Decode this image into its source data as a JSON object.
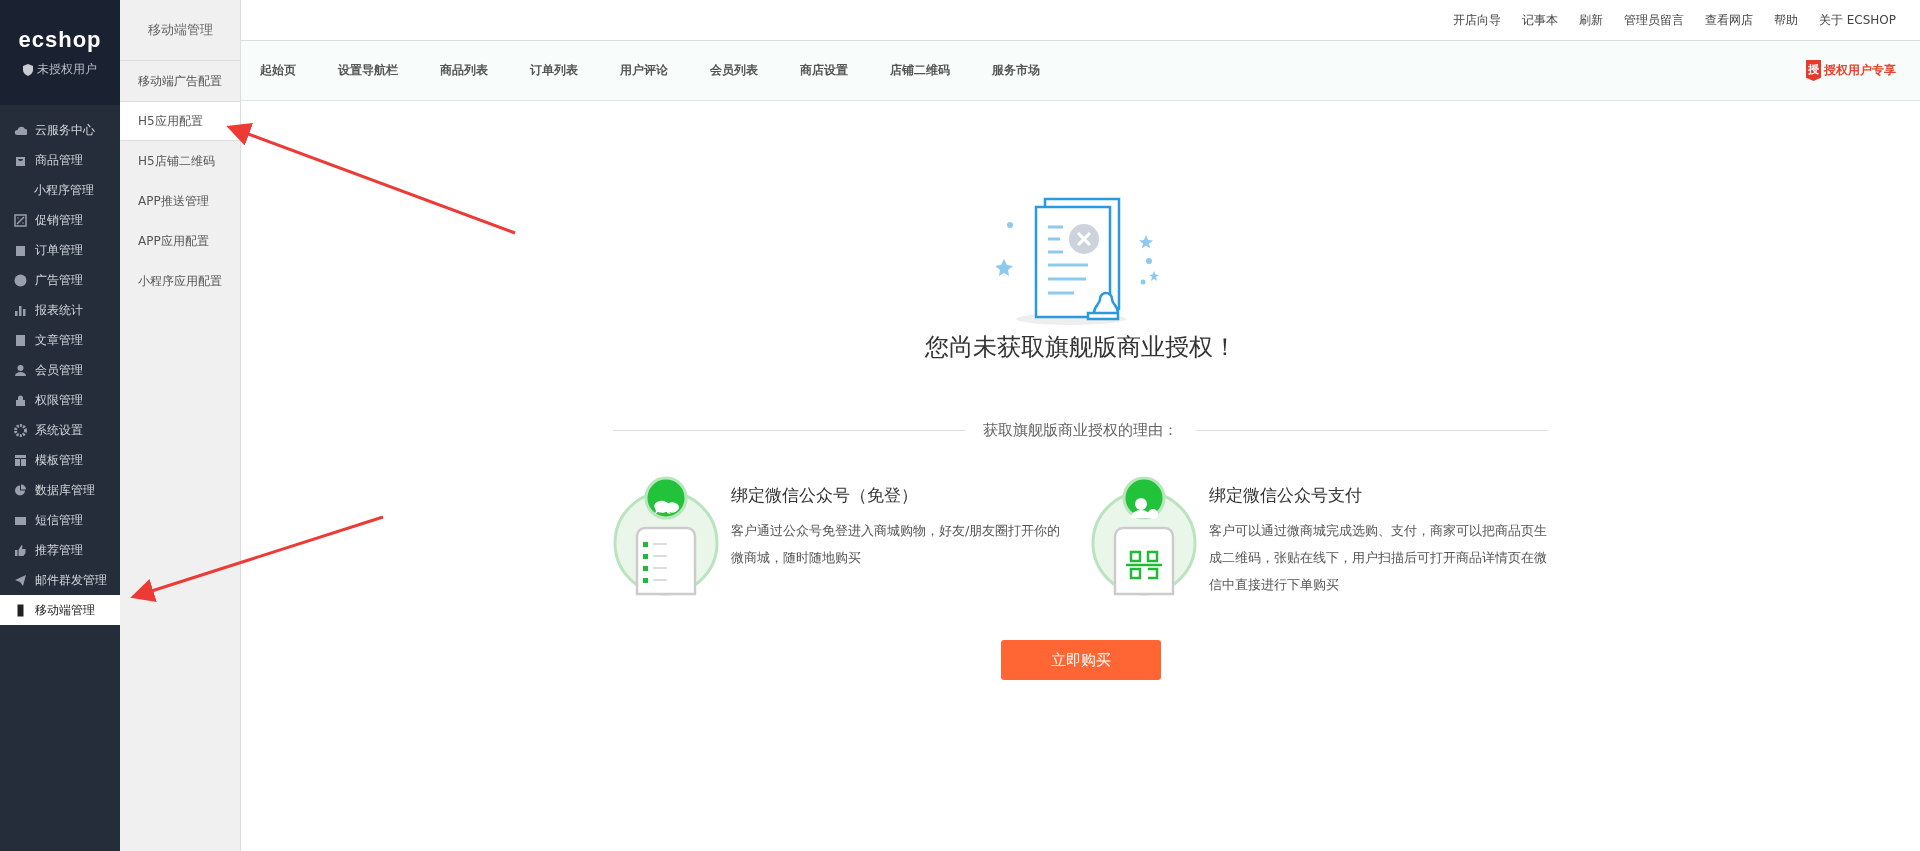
{
  "brand": {
    "logo": "ecshop",
    "user": "未授权用户"
  },
  "sidebar": {
    "items": [
      {
        "label": "云服务中心",
        "selected": false
      },
      {
        "label": "商品管理",
        "selected": false,
        "children": [
          {
            "label": "小程序管理",
            "selected": false
          }
        ]
      },
      {
        "label": "促销管理",
        "selected": false
      },
      {
        "label": "订单管理",
        "selected": false
      },
      {
        "label": "广告管理",
        "selected": false
      },
      {
        "label": "报表统计",
        "selected": false
      },
      {
        "label": "文章管理",
        "selected": false
      },
      {
        "label": "会员管理",
        "selected": false
      },
      {
        "label": "权限管理",
        "selected": false
      },
      {
        "label": "系统设置",
        "selected": false
      },
      {
        "label": "模板管理",
        "selected": false
      },
      {
        "label": "数据库管理",
        "selected": false
      },
      {
        "label": "短信管理",
        "selected": false
      },
      {
        "label": "推荐管理",
        "selected": false
      },
      {
        "label": "邮件群发管理",
        "selected": false
      },
      {
        "label": "移动端管理",
        "selected": true
      }
    ]
  },
  "subnav": {
    "title": "移动端管理",
    "items": [
      {
        "label": "移动端广告配置",
        "selected": false
      },
      {
        "label": "H5应用配置",
        "selected": true
      },
      {
        "label": "H5店铺二维码",
        "selected": false
      },
      {
        "label": "APP推送管理",
        "selected": false
      },
      {
        "label": "APP应用配置",
        "selected": false
      },
      {
        "label": "小程序应用配置",
        "selected": false
      }
    ]
  },
  "top_links": [
    "开店向导",
    "记事本",
    "刷新",
    "管理员留言",
    "查看网店",
    "帮助",
    "关于 ECSHOP"
  ],
  "nav": {
    "items": [
      "起始页",
      "设置导航栏",
      "商品列表",
      "订单列表",
      "用户评论",
      "会员列表",
      "商店设置",
      "店铺二维码",
      "服务市场"
    ],
    "badge_icon": "授",
    "badge": "授权用户专享"
  },
  "notice": {
    "title": "您尚未获取旗舰版商业授权！",
    "reasons_heading": "获取旗舰版商业授权的理由：",
    "reasons": [
      {
        "kind": "wechat",
        "title": "绑定微信公众号（免登）",
        "text": "客户通过公众号免登进入商城购物，好友/朋友圈打开你的微商城，随时随地购买"
      },
      {
        "kind": "pay",
        "title": "绑定微信公众号支付",
        "text": "客户可以通过微商城完成选购、支付，商家可以把商品页生成二维码，张贴在线下，用户扫描后可打开商品详情页在微信中直接进行下单购买"
      }
    ],
    "button": "立即购买"
  }
}
